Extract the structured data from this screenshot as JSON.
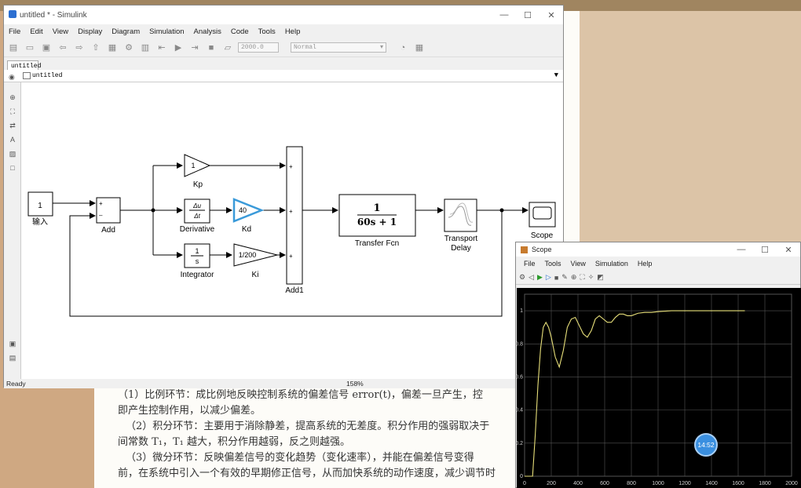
{
  "simulink": {
    "title": "untitled * - Simulink",
    "menu": [
      "File",
      "Edit",
      "View",
      "Display",
      "Diagram",
      "Simulation",
      "Analysis",
      "Code",
      "Tools",
      "Help"
    ],
    "stop_time": "2000.0",
    "sim_mode": "Normal",
    "tab": "untitled",
    "breadcrumb": "untitled",
    "status": "Ready",
    "zoom": "158%"
  },
  "blocks": {
    "constant": "1",
    "input_label": "输入",
    "add_label": "Add",
    "add_sign_plus": "+",
    "add_sign_minus": "–",
    "kp_value": "1",
    "kp_label": "Kp",
    "deriv_num": "Δu",
    "deriv_den": "Δt",
    "deriv_label": "Derivative",
    "kd_value": "40",
    "kd_label": "Kd",
    "integ_num": "1",
    "integ_den": "s",
    "integ_label": "Integrator",
    "ki_value": "1/200",
    "ki_label": "Ki",
    "add1_label": "Add1",
    "add1_signs": [
      "+",
      "+",
      "+"
    ],
    "tf_num": "1",
    "tf_den": "60s + 1",
    "tf_label": "Transfer Fcn",
    "delay_label_1": "Transport",
    "delay_label_2": "Delay",
    "scope_label": "Scope"
  },
  "document": {
    "lines": [
      "（1）比例环节：成比例地反映控制系统的偏差信号 error(t)，偏差一旦产生，控",
      "即产生控制作用，以减少偏差。",
      "（2）积分环节：主要用于消除静差，提高系统的无差度。积分作用的强弱取决于",
      "间常数 T₁，T₁ 越大，积分作用越弱，反之则越强。",
      "（3）微分环节：反映偏差信号的变化趋势（变化速率），并能在偏差信号变得",
      "前，在系统中引入一个有效的早期修正信号，从而加快系统的动作速度，减少调节时"
    ]
  },
  "scope": {
    "title": "Scope",
    "menu": [
      "File",
      "Tools",
      "View",
      "Simulation",
      "Help"
    ]
  },
  "timer": "14:52",
  "chart_data": {
    "type": "line",
    "title": "",
    "xlabel": "",
    "ylabel": "",
    "xlim": [
      0,
      2000
    ],
    "ylim": [
      0,
      1.1
    ],
    "xticks": [
      "0",
      "200",
      "400",
      "600",
      "800",
      "1000",
      "1200",
      "1400",
      "1600",
      "1800",
      "2000"
    ],
    "yticks": [
      "0",
      "0.2",
      "0.4",
      "0.6",
      "0.8",
      "1"
    ],
    "grid": true,
    "colors": {
      "background": "#000000",
      "line": "#e8e07a",
      "grid": "#555555"
    },
    "series": [
      {
        "x": [
          0,
          60,
          80,
          100,
          120,
          140,
          160,
          180,
          200,
          230,
          260,
          290,
          320,
          350,
          380,
          410,
          440,
          470,
          500,
          530,
          560,
          590,
          620,
          650,
          680,
          710,
          740,
          770,
          800,
          850,
          900,
          950,
          1000,
          1100,
          1200,
          1300,
          1400,
          1500,
          1600,
          1650
        ],
        "y": [
          0,
          0,
          0.25,
          0.55,
          0.77,
          0.9,
          0.93,
          0.9,
          0.84,
          0.72,
          0.66,
          0.76,
          0.9,
          0.95,
          0.96,
          0.91,
          0.86,
          0.84,
          0.88,
          0.95,
          0.97,
          0.95,
          0.93,
          0.93,
          0.96,
          0.98,
          0.98,
          0.97,
          0.97,
          0.985,
          0.99,
          0.99,
          0.995,
          1.0,
          1.0,
          1.0,
          1.0,
          1.0,
          1.0,
          1.0
        ]
      }
    ]
  }
}
